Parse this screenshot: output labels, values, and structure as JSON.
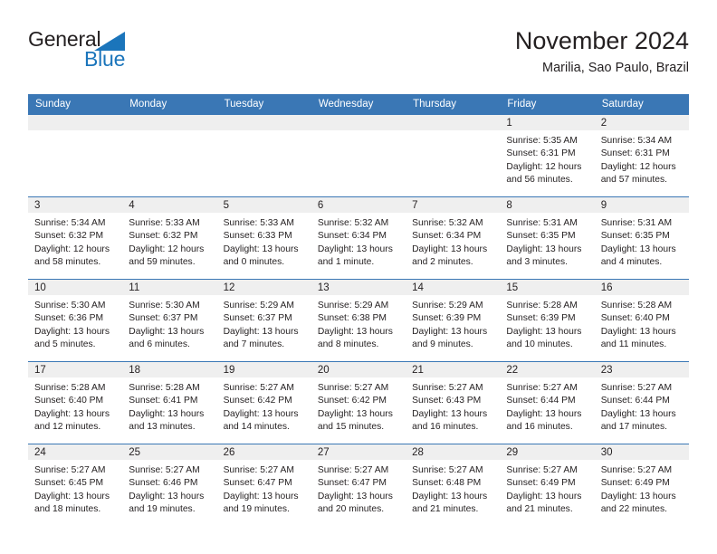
{
  "brand": {
    "word_one": "General",
    "word_two": "Blue",
    "triangle_color": "#1b75bb"
  },
  "header": {
    "title": "November 2024",
    "subtitle": "Marilia, Sao Paulo, Brazil",
    "accent_color": "#3a77b5",
    "daynum_band_color": "#efefef"
  },
  "weekdays": [
    "Sunday",
    "Monday",
    "Tuesday",
    "Wednesday",
    "Thursday",
    "Friday",
    "Saturday"
  ],
  "weeks": [
    [
      {
        "day": "",
        "blank": true,
        "sunrise": "",
        "sunset": "",
        "daylight": "",
        "daylight2": ""
      },
      {
        "day": "",
        "blank": true,
        "sunrise": "",
        "sunset": "",
        "daylight": "",
        "daylight2": ""
      },
      {
        "day": "",
        "blank": true,
        "sunrise": "",
        "sunset": "",
        "daylight": "",
        "daylight2": ""
      },
      {
        "day": "",
        "blank": true,
        "sunrise": "",
        "sunset": "",
        "daylight": "",
        "daylight2": ""
      },
      {
        "day": "",
        "blank": true,
        "sunrise": "",
        "sunset": "",
        "daylight": "",
        "daylight2": ""
      },
      {
        "day": "1",
        "blank": false,
        "sunrise": "Sunrise: 5:35 AM",
        "sunset": "Sunset: 6:31 PM",
        "daylight": "Daylight: 12 hours",
        "daylight2": "and 56 minutes."
      },
      {
        "day": "2",
        "blank": false,
        "sunrise": "Sunrise: 5:34 AM",
        "sunset": "Sunset: 6:31 PM",
        "daylight": "Daylight: 12 hours",
        "daylight2": "and 57 minutes."
      }
    ],
    [
      {
        "day": "3",
        "blank": false,
        "sunrise": "Sunrise: 5:34 AM",
        "sunset": "Sunset: 6:32 PM",
        "daylight": "Daylight: 12 hours",
        "daylight2": "and 58 minutes."
      },
      {
        "day": "4",
        "blank": false,
        "sunrise": "Sunrise: 5:33 AM",
        "sunset": "Sunset: 6:32 PM",
        "daylight": "Daylight: 12 hours",
        "daylight2": "and 59 minutes."
      },
      {
        "day": "5",
        "blank": false,
        "sunrise": "Sunrise: 5:33 AM",
        "sunset": "Sunset: 6:33 PM",
        "daylight": "Daylight: 13 hours",
        "daylight2": "and 0 minutes."
      },
      {
        "day": "6",
        "blank": false,
        "sunrise": "Sunrise: 5:32 AM",
        "sunset": "Sunset: 6:34 PM",
        "daylight": "Daylight: 13 hours",
        "daylight2": "and 1 minute."
      },
      {
        "day": "7",
        "blank": false,
        "sunrise": "Sunrise: 5:32 AM",
        "sunset": "Sunset: 6:34 PM",
        "daylight": "Daylight: 13 hours",
        "daylight2": "and 2 minutes."
      },
      {
        "day": "8",
        "blank": false,
        "sunrise": "Sunrise: 5:31 AM",
        "sunset": "Sunset: 6:35 PM",
        "daylight": "Daylight: 13 hours",
        "daylight2": "and 3 minutes."
      },
      {
        "day": "9",
        "blank": false,
        "sunrise": "Sunrise: 5:31 AM",
        "sunset": "Sunset: 6:35 PM",
        "daylight": "Daylight: 13 hours",
        "daylight2": "and 4 minutes."
      }
    ],
    [
      {
        "day": "10",
        "blank": false,
        "sunrise": "Sunrise: 5:30 AM",
        "sunset": "Sunset: 6:36 PM",
        "daylight": "Daylight: 13 hours",
        "daylight2": "and 5 minutes."
      },
      {
        "day": "11",
        "blank": false,
        "sunrise": "Sunrise: 5:30 AM",
        "sunset": "Sunset: 6:37 PM",
        "daylight": "Daylight: 13 hours",
        "daylight2": "and 6 minutes."
      },
      {
        "day": "12",
        "blank": false,
        "sunrise": "Sunrise: 5:29 AM",
        "sunset": "Sunset: 6:37 PM",
        "daylight": "Daylight: 13 hours",
        "daylight2": "and 7 minutes."
      },
      {
        "day": "13",
        "blank": false,
        "sunrise": "Sunrise: 5:29 AM",
        "sunset": "Sunset: 6:38 PM",
        "daylight": "Daylight: 13 hours",
        "daylight2": "and 8 minutes."
      },
      {
        "day": "14",
        "blank": false,
        "sunrise": "Sunrise: 5:29 AM",
        "sunset": "Sunset: 6:39 PM",
        "daylight": "Daylight: 13 hours",
        "daylight2": "and 9 minutes."
      },
      {
        "day": "15",
        "blank": false,
        "sunrise": "Sunrise: 5:28 AM",
        "sunset": "Sunset: 6:39 PM",
        "daylight": "Daylight: 13 hours",
        "daylight2": "and 10 minutes."
      },
      {
        "day": "16",
        "blank": false,
        "sunrise": "Sunrise: 5:28 AM",
        "sunset": "Sunset: 6:40 PM",
        "daylight": "Daylight: 13 hours",
        "daylight2": "and 11 minutes."
      }
    ],
    [
      {
        "day": "17",
        "blank": false,
        "sunrise": "Sunrise: 5:28 AM",
        "sunset": "Sunset: 6:40 PM",
        "daylight": "Daylight: 13 hours",
        "daylight2": "and 12 minutes."
      },
      {
        "day": "18",
        "blank": false,
        "sunrise": "Sunrise: 5:28 AM",
        "sunset": "Sunset: 6:41 PM",
        "daylight": "Daylight: 13 hours",
        "daylight2": "and 13 minutes."
      },
      {
        "day": "19",
        "blank": false,
        "sunrise": "Sunrise: 5:27 AM",
        "sunset": "Sunset: 6:42 PM",
        "daylight": "Daylight: 13 hours",
        "daylight2": "and 14 minutes."
      },
      {
        "day": "20",
        "blank": false,
        "sunrise": "Sunrise: 5:27 AM",
        "sunset": "Sunset: 6:42 PM",
        "daylight": "Daylight: 13 hours",
        "daylight2": "and 15 minutes."
      },
      {
        "day": "21",
        "blank": false,
        "sunrise": "Sunrise: 5:27 AM",
        "sunset": "Sunset: 6:43 PM",
        "daylight": "Daylight: 13 hours",
        "daylight2": "and 16 minutes."
      },
      {
        "day": "22",
        "blank": false,
        "sunrise": "Sunrise: 5:27 AM",
        "sunset": "Sunset: 6:44 PM",
        "daylight": "Daylight: 13 hours",
        "daylight2": "and 16 minutes."
      },
      {
        "day": "23",
        "blank": false,
        "sunrise": "Sunrise: 5:27 AM",
        "sunset": "Sunset: 6:44 PM",
        "daylight": "Daylight: 13 hours",
        "daylight2": "and 17 minutes."
      }
    ],
    [
      {
        "day": "24",
        "blank": false,
        "sunrise": "Sunrise: 5:27 AM",
        "sunset": "Sunset: 6:45 PM",
        "daylight": "Daylight: 13 hours",
        "daylight2": "and 18 minutes."
      },
      {
        "day": "25",
        "blank": false,
        "sunrise": "Sunrise: 5:27 AM",
        "sunset": "Sunset: 6:46 PM",
        "daylight": "Daylight: 13 hours",
        "daylight2": "and 19 minutes."
      },
      {
        "day": "26",
        "blank": false,
        "sunrise": "Sunrise: 5:27 AM",
        "sunset": "Sunset: 6:47 PM",
        "daylight": "Daylight: 13 hours",
        "daylight2": "and 19 minutes."
      },
      {
        "day": "27",
        "blank": false,
        "sunrise": "Sunrise: 5:27 AM",
        "sunset": "Sunset: 6:47 PM",
        "daylight": "Daylight: 13 hours",
        "daylight2": "and 20 minutes."
      },
      {
        "day": "28",
        "blank": false,
        "sunrise": "Sunrise: 5:27 AM",
        "sunset": "Sunset: 6:48 PM",
        "daylight": "Daylight: 13 hours",
        "daylight2": "and 21 minutes."
      },
      {
        "day": "29",
        "blank": false,
        "sunrise": "Sunrise: 5:27 AM",
        "sunset": "Sunset: 6:49 PM",
        "daylight": "Daylight: 13 hours",
        "daylight2": "and 21 minutes."
      },
      {
        "day": "30",
        "blank": false,
        "sunrise": "Sunrise: 5:27 AM",
        "sunset": "Sunset: 6:49 PM",
        "daylight": "Daylight: 13 hours",
        "daylight2": "and 22 minutes."
      }
    ]
  ]
}
